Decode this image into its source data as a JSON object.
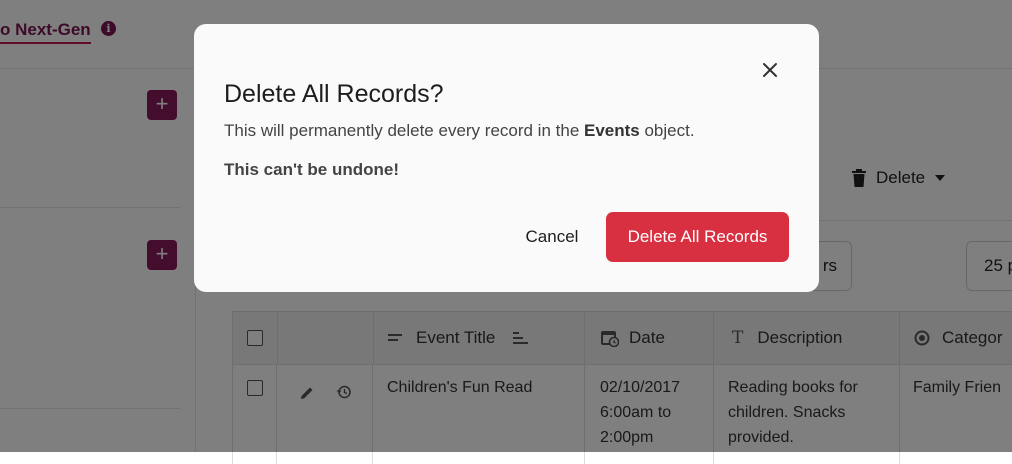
{
  "app": {
    "nextgen_link": "o Next-Gen",
    "info_icon": "i"
  },
  "toolbar": {
    "delete_label": "Delete",
    "filters_label": "rs",
    "per_page_label": "25 p"
  },
  "table": {
    "columns": [
      {
        "label": "Event Title",
        "icon": "text-lines-icon"
      },
      {
        "label": "Date",
        "icon": "calendar-clock-icon"
      },
      {
        "label": "Description",
        "icon": "text-t-icon"
      },
      {
        "label": "Categor",
        "icon": "radio-icon"
      }
    ],
    "rows": [
      {
        "title": "Children's Fun Read",
        "date": "02/10/2017 6:00am to 2:00pm",
        "description": "Reading books for children. Snacks provided.",
        "category": "Family Frien"
      }
    ]
  },
  "modal": {
    "title": "Delete All Records?",
    "body_prefix": "This will permanently delete every record in the ",
    "body_object": "Events",
    "body_suffix": " object.",
    "warning": "This can't be undone!",
    "cancel_label": "Cancel",
    "confirm_label": "Delete All Records",
    "confirm_color": "#d93041"
  }
}
